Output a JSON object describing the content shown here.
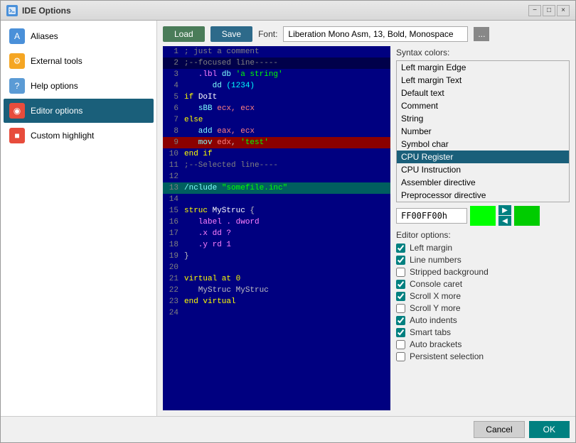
{
  "window": {
    "title": "IDE Options",
    "min_label": "−",
    "max_label": "□",
    "close_label": "×"
  },
  "sidebar": {
    "items": [
      {
        "id": "aliases",
        "label": "Aliases",
        "icon": "A",
        "icon_class": "icon-aliases",
        "active": false
      },
      {
        "id": "external-tools",
        "label": "External tools",
        "icon": "⚙",
        "icon_class": "icon-external",
        "active": false
      },
      {
        "id": "help-options",
        "label": "Help options",
        "icon": "?",
        "icon_class": "icon-help",
        "active": false
      },
      {
        "id": "editor-options",
        "label": "Editor options",
        "icon": "◉",
        "icon_class": "icon-editor",
        "active": true
      },
      {
        "id": "custom-highlight",
        "label": "Custom highlight",
        "icon": "■",
        "icon_class": "icon-highlight",
        "active": false
      }
    ]
  },
  "toolbar": {
    "load_label": "Load",
    "save_label": "Save",
    "font_label": "Font:",
    "font_value": "Liberation Mono Asm, 13, Bold, Monospace",
    "font_btn_label": "..."
  },
  "syntax_colors": {
    "title": "Syntax colors:",
    "items": [
      {
        "label": "Left margin Edge",
        "selected": false
      },
      {
        "label": "Left margin Text",
        "selected": false
      },
      {
        "label": "Default text",
        "selected": false
      },
      {
        "label": "Comment",
        "selected": false
      },
      {
        "label": "String",
        "selected": false
      },
      {
        "label": "Number",
        "selected": false
      },
      {
        "label": "Symbol char",
        "selected": false
      },
      {
        "label": "CPU Register",
        "selected": true
      },
      {
        "label": "CPU Instruction",
        "selected": false
      },
      {
        "label": "Assembler directive",
        "selected": false
      },
      {
        "label": "Preprocessor directive",
        "selected": false
      }
    ],
    "color_value": "FF00FF00h",
    "color_hex": "#00ff00"
  },
  "editor_options": {
    "title": "Editor options:",
    "checkboxes": [
      {
        "label": "Left margin",
        "checked": true,
        "id": "cb-left-margin"
      },
      {
        "label": "Line numbers",
        "checked": true,
        "id": "cb-line-numbers"
      },
      {
        "label": "Stripped background",
        "checked": false,
        "id": "cb-stripped-bg"
      },
      {
        "label": "Console caret",
        "checked": true,
        "id": "cb-console-caret"
      },
      {
        "label": "Scroll X more",
        "checked": true,
        "id": "cb-scroll-x"
      },
      {
        "label": "Scroll Y more",
        "checked": false,
        "id": "cb-scroll-y"
      },
      {
        "label": "Auto indents",
        "checked": true,
        "id": "cb-auto-indents"
      },
      {
        "label": "Smart tabs",
        "checked": true,
        "id": "cb-smart-tabs"
      },
      {
        "label": "Auto brackets",
        "checked": false,
        "id": "cb-auto-brackets"
      },
      {
        "label": "Persistent selection",
        "checked": false,
        "id": "cb-persistent-sel"
      }
    ]
  },
  "footer": {
    "cancel_label": "Cancel",
    "ok_label": "OK"
  },
  "code_lines": [
    {
      "num": 1,
      "content": "; just a comment",
      "classes": "c-comment"
    },
    {
      "num": 2,
      "content": ";--focused line-----",
      "classes": "c-comment",
      "bg": "line-focused"
    },
    {
      "num": 3,
      "content": "",
      "parts": [
        {
          "text": "   .lbl ",
          "cls": "c-directive"
        },
        {
          "text": "db",
          "cls": "c-instruction"
        },
        {
          "text": " 'a string'",
          "cls": "c-string"
        }
      ]
    },
    {
      "num": 4,
      "content": "",
      "parts": [
        {
          "text": "      dd ",
          "cls": "c-instruction"
        },
        {
          "text": "(1234)",
          "cls": "c-number"
        }
      ]
    },
    {
      "num": 5,
      "content": "",
      "parts": [
        {
          "text": "if ",
          "cls": "c-keyword"
        },
        {
          "text": "DoIt",
          "cls": "c-label"
        }
      ]
    },
    {
      "num": 6,
      "content": "",
      "parts": [
        {
          "text": "   ",
          "cls": ""
        },
        {
          "text": "sBB",
          "cls": "c-instruction"
        },
        {
          "text": " ecx, ecx",
          "cls": "c-register"
        }
      ]
    },
    {
      "num": 7,
      "content": "",
      "parts": [
        {
          "text": "else",
          "cls": "c-keyword"
        }
      ]
    },
    {
      "num": 8,
      "content": "",
      "parts": [
        {
          "text": "   add ",
          "cls": "c-instruction"
        },
        {
          "text": "eax, ecx",
          "cls": "c-register"
        }
      ]
    },
    {
      "num": 9,
      "content": "",
      "bg": "line-selected",
      "parts": [
        {
          "text": "   mov ",
          "cls": "c-instruction"
        },
        {
          "text": "edx",
          "cls": "c-register"
        },
        {
          "text": ", ",
          "cls": "c-default"
        },
        {
          "text": "'test'",
          "cls": "c-string"
        }
      ]
    },
    {
      "num": 10,
      "content": "",
      "parts": [
        {
          "text": "end if",
          "cls": "c-keyword"
        }
      ]
    },
    {
      "num": 11,
      "content": "",
      "parts": [
        {
          "text": ";--Selected line----",
          "cls": "c-comment"
        }
      ]
    },
    {
      "num": 12,
      "content": ""
    },
    {
      "num": 13,
      "content": "",
      "bg": "line-selected-blue",
      "parts": [
        {
          "text": "/nclude ",
          "cls": "c-instruction"
        },
        {
          "text": "\"somefile.inc\"",
          "cls": "c-string"
        }
      ]
    },
    {
      "num": 14,
      "content": ""
    },
    {
      "num": 15,
      "content": "",
      "parts": [
        {
          "text": "struc ",
          "cls": "c-keyword"
        },
        {
          "text": "MyStruc",
          "cls": "c-label"
        },
        {
          "text": " {",
          "cls": "c-default"
        }
      ]
    },
    {
      "num": 16,
      "content": "",
      "parts": [
        {
          "text": "   label . dword",
          "cls": "c-directive"
        }
      ]
    },
    {
      "num": 17,
      "content": "",
      "parts": [
        {
          "text": "   .x dd ?",
          "cls": "c-directive"
        }
      ]
    },
    {
      "num": 18,
      "content": "",
      "parts": [
        {
          "text": "   .y rd 1",
          "cls": "c-directive"
        }
      ]
    },
    {
      "num": 19,
      "content": "",
      "parts": [
        {
          "text": "}",
          "cls": "c-default"
        }
      ]
    },
    {
      "num": 20,
      "content": ""
    },
    {
      "num": 21,
      "content": "",
      "parts": [
        {
          "text": "virtual at 0",
          "cls": "c-keyword"
        }
      ]
    },
    {
      "num": 22,
      "content": "",
      "parts": [
        {
          "text": "   MyStruc MyStruc",
          "cls": "c-default"
        }
      ]
    },
    {
      "num": 23,
      "content": "",
      "parts": [
        {
          "text": "end virtual",
          "cls": "c-keyword"
        }
      ]
    },
    {
      "num": 24,
      "content": ""
    }
  ]
}
